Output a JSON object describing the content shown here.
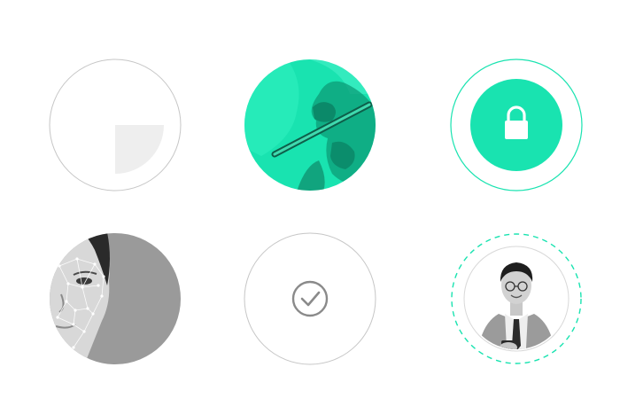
{
  "colors": {
    "accent": "#19e3b0",
    "outline": "#c6c6c6",
    "placeholder": "#eeeeee",
    "check": "#8a8a8a",
    "photo_gray": "#9a9a9a"
  },
  "icons": {
    "progress": "quarter-wedge-icon",
    "signing": "hand-with-stylus-photo",
    "security": "lock-icon",
    "biometric": "face-mesh-photo",
    "verified": "checkmark-icon",
    "identity": "user-portrait-photo"
  }
}
